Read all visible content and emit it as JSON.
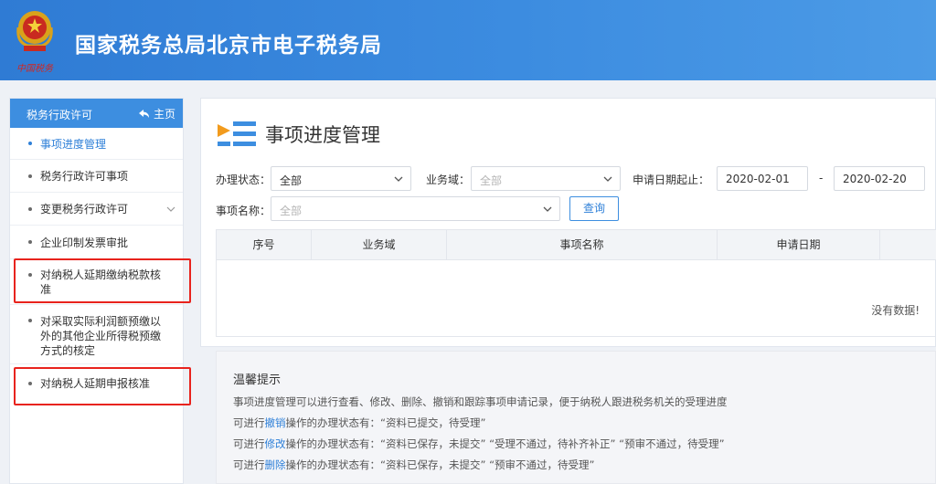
{
  "header": {
    "title": "国家税务总局北京市电子税务局",
    "emblem_text": "中国税务"
  },
  "sidebar": {
    "title": "税务行政许可",
    "home_label": "主页",
    "items": [
      {
        "label": "事项进度管理",
        "active": true
      },
      {
        "label": "税务行政许可事项"
      },
      {
        "label": "变更税务行政许可",
        "has_submenu": true
      },
      {
        "label": "企业印制发票审批"
      },
      {
        "label_lines": [
          "对纳税人延期缴纳税款核",
          "准"
        ],
        "highlighted": true
      },
      {
        "label_lines": [
          "对采取实际利润额预缴以",
          "外的其他企业所得税预缴",
          "方式的核定"
        ]
      },
      {
        "label": "对纳税人延期申报核准",
        "highlighted": true
      }
    ]
  },
  "main": {
    "title": "事项进度管理",
    "filters": {
      "status_label": "办理状态：",
      "status_value": "全部",
      "domain_label": "业务域：",
      "domain_placeholder": "全部",
      "date_label": "申请日期起止：",
      "date_start": "2020-02-01",
      "date_sep": "-",
      "date_end": "2020-02-20",
      "name_label": "事项名称：",
      "name_placeholder": "全部",
      "query_button": "查询"
    },
    "table": {
      "columns": [
        "序号",
        "业务域",
        "事项名称",
        "申请日期"
      ],
      "empty_text": "没有数据!"
    }
  },
  "tips": {
    "title": "温馨提示",
    "line1": "事项进度管理可以进行查看、修改、删除、撤销和跟踪事项申请记录，便于纳税人跟进税务机关的受理进度",
    "line2": {
      "pre": "可进行",
      "action": "撤销",
      "post": "操作的办理状态有：“资料已提交，待受理”"
    },
    "line3": {
      "pre": "可进行",
      "action": "修改",
      "post": "操作的办理状态有：“资料已保存，未提交”   “受理不通过，待补齐补正”   “预审不通过，待受理”"
    },
    "line4": {
      "pre": "可进行",
      "action": "删除",
      "post": "操作的办理状态有：“资料已保存，未提交”   “预审不通过，待受理”"
    }
  },
  "colors": {
    "header_blue": "#3c8ce0",
    "accent": "#2f80d8",
    "highlight_box": "#e8231d"
  }
}
